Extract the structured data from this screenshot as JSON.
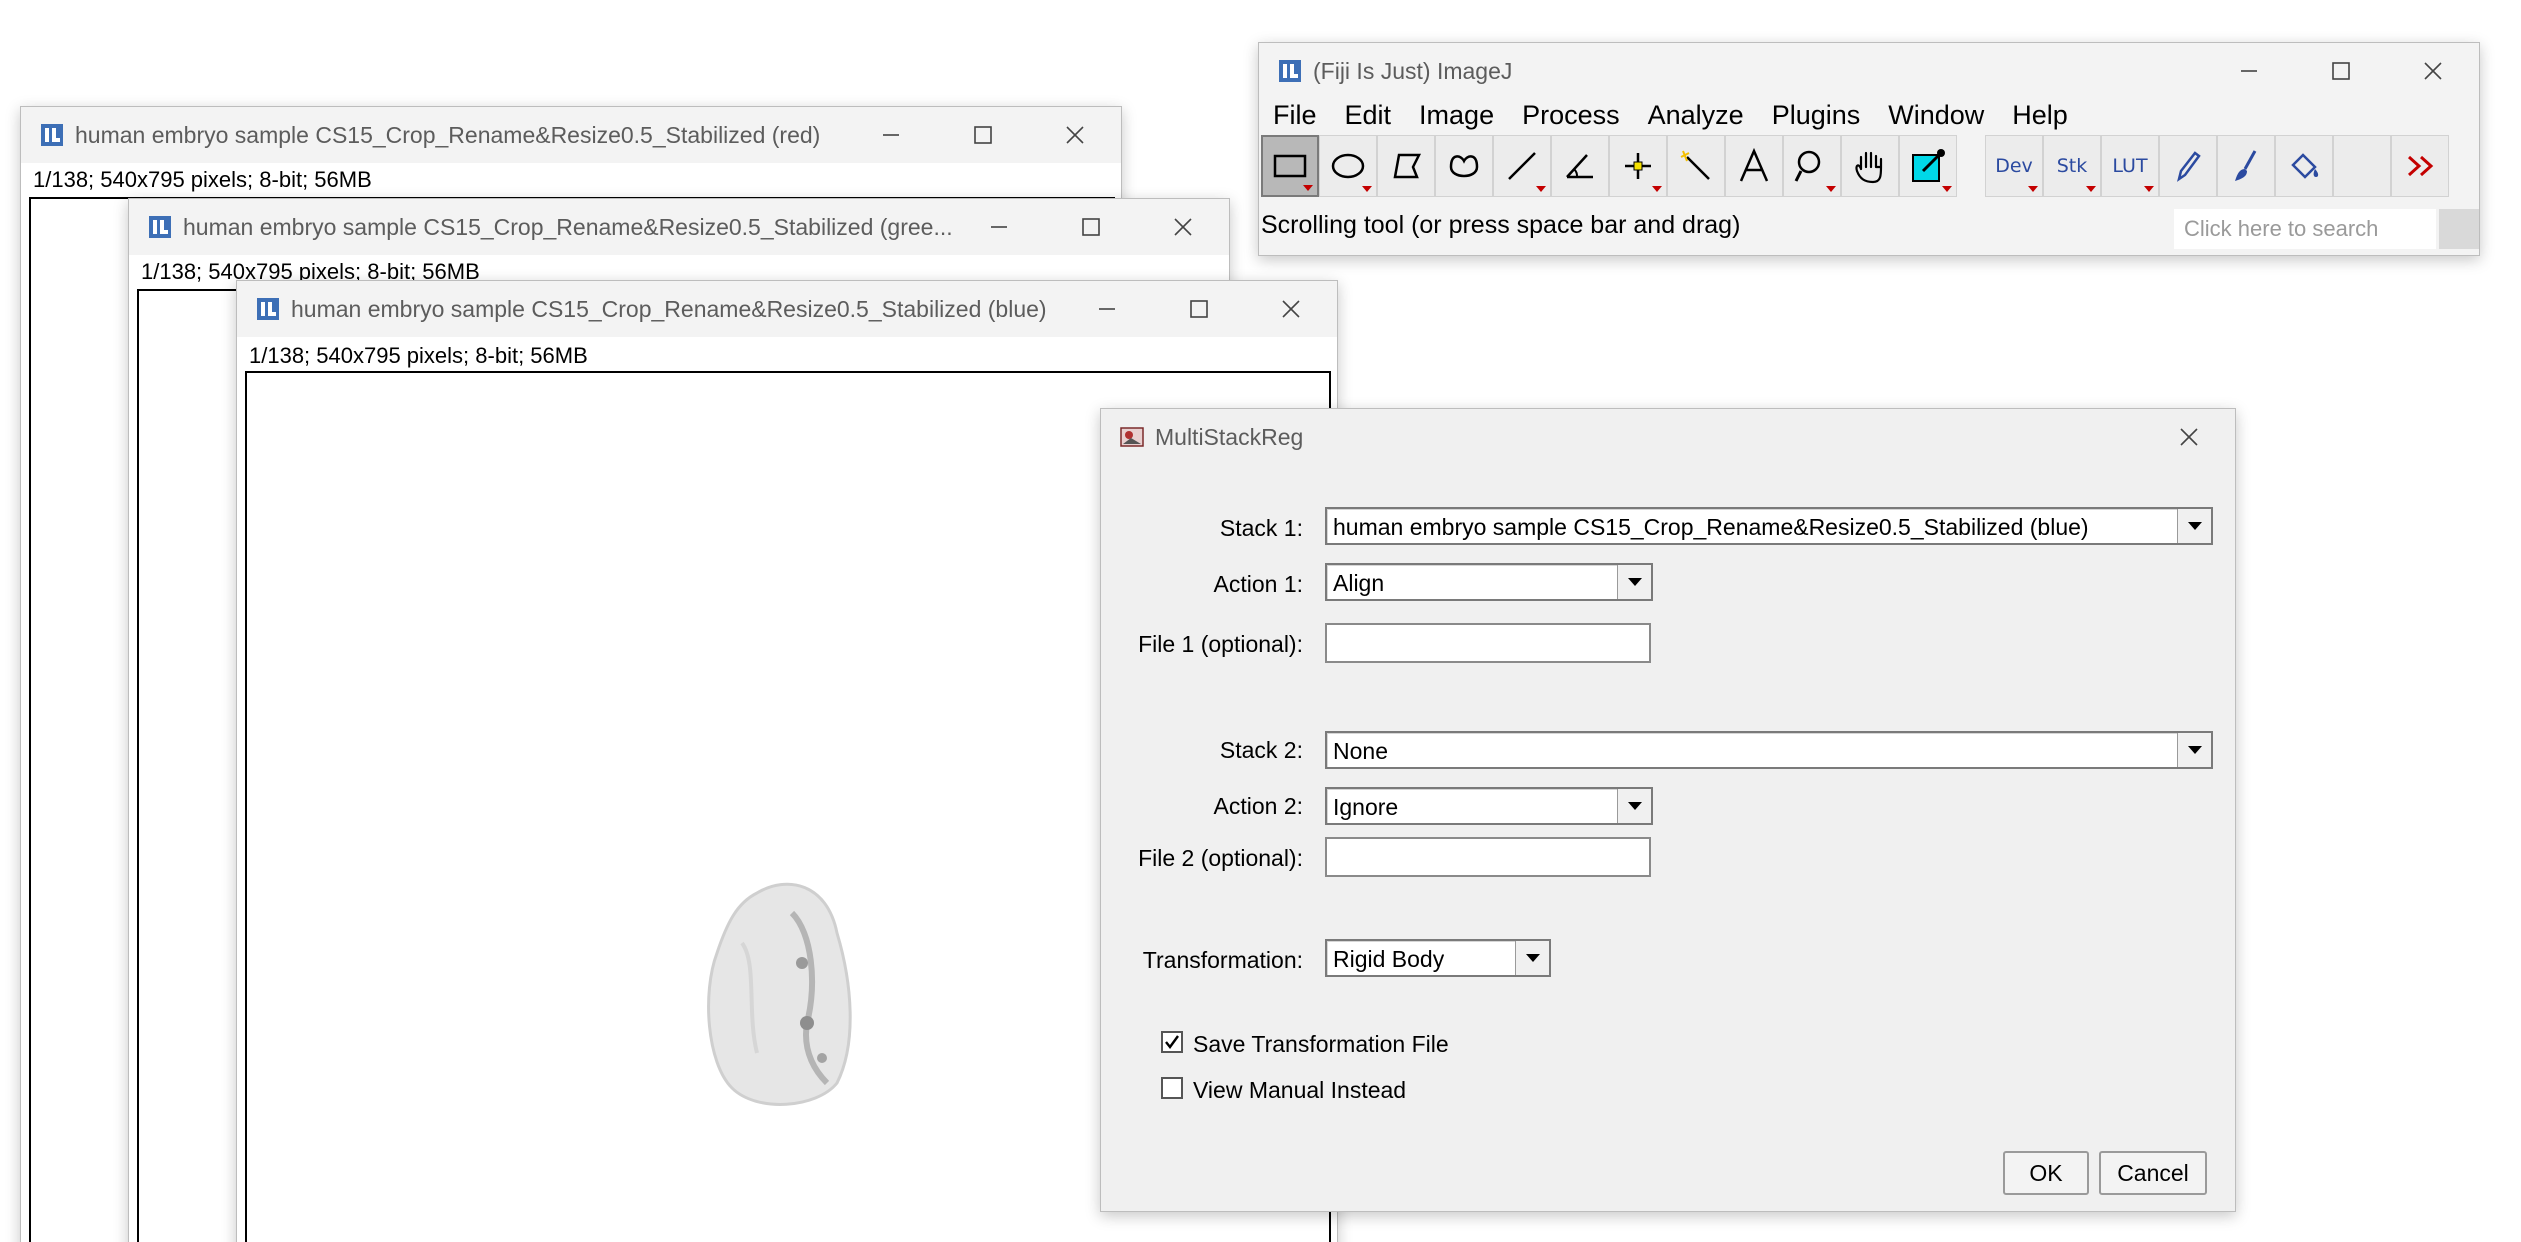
{
  "red_window": {
    "title": "human embryo sample CS15_Crop_Rename&Resize0.5_Stabilized (red)",
    "info": "1/138; 540x795 pixels; 8-bit; 56MB"
  },
  "green_window": {
    "title": "human embryo sample CS15_Crop_Rename&Resize0.5_Stabilized (gree...",
    "info": "1/138; 540x795 pixels; 8-bit; 56MB"
  },
  "blue_window": {
    "title": "human embryo sample CS15_Crop_Rename&Resize0.5_Stabilized (blue)",
    "info": "1/138; 540x795 pixels; 8-bit; 56MB"
  },
  "imagej": {
    "title": "(Fiji Is Just) ImageJ",
    "menus": [
      "File",
      "Edit",
      "Image",
      "Process",
      "Analyze",
      "Plugins",
      "Window",
      "Help"
    ],
    "tools": {
      "dev": "Dev",
      "stk": "Stk",
      "lut": "LUT"
    },
    "status": "Scrolling tool (or press space bar and drag)",
    "search_placeholder": "Click here to search"
  },
  "dialog": {
    "title": "MultiStackReg",
    "stack1_label": "Stack 1:",
    "stack1_value": "human embryo sample CS15_Crop_Rename&Resize0.5_Stabilized (blue)",
    "action1_label": "Action 1:",
    "action1_value": "Align",
    "file1_label": "File 1 (optional):",
    "file1_value": "",
    "stack2_label": "Stack 2:",
    "stack2_value": "None",
    "action2_label": "Action 2:",
    "action2_value": "Ignore",
    "file2_label": "File 2 (optional):",
    "file2_value": "",
    "transformation_label": "Transformation:",
    "transformation_value": "Rigid Body",
    "save_transformation_label": "Save Transformation File",
    "save_transformation_checked": true,
    "view_manual_label": "View Manual Instead",
    "view_manual_checked": false,
    "ok_label": "OK",
    "cancel_label": "Cancel"
  },
  "colors": {
    "accent_red": "#c40000",
    "icon_blue": "#2b4aa0",
    "color_picker_fill": "#00d8e8"
  }
}
